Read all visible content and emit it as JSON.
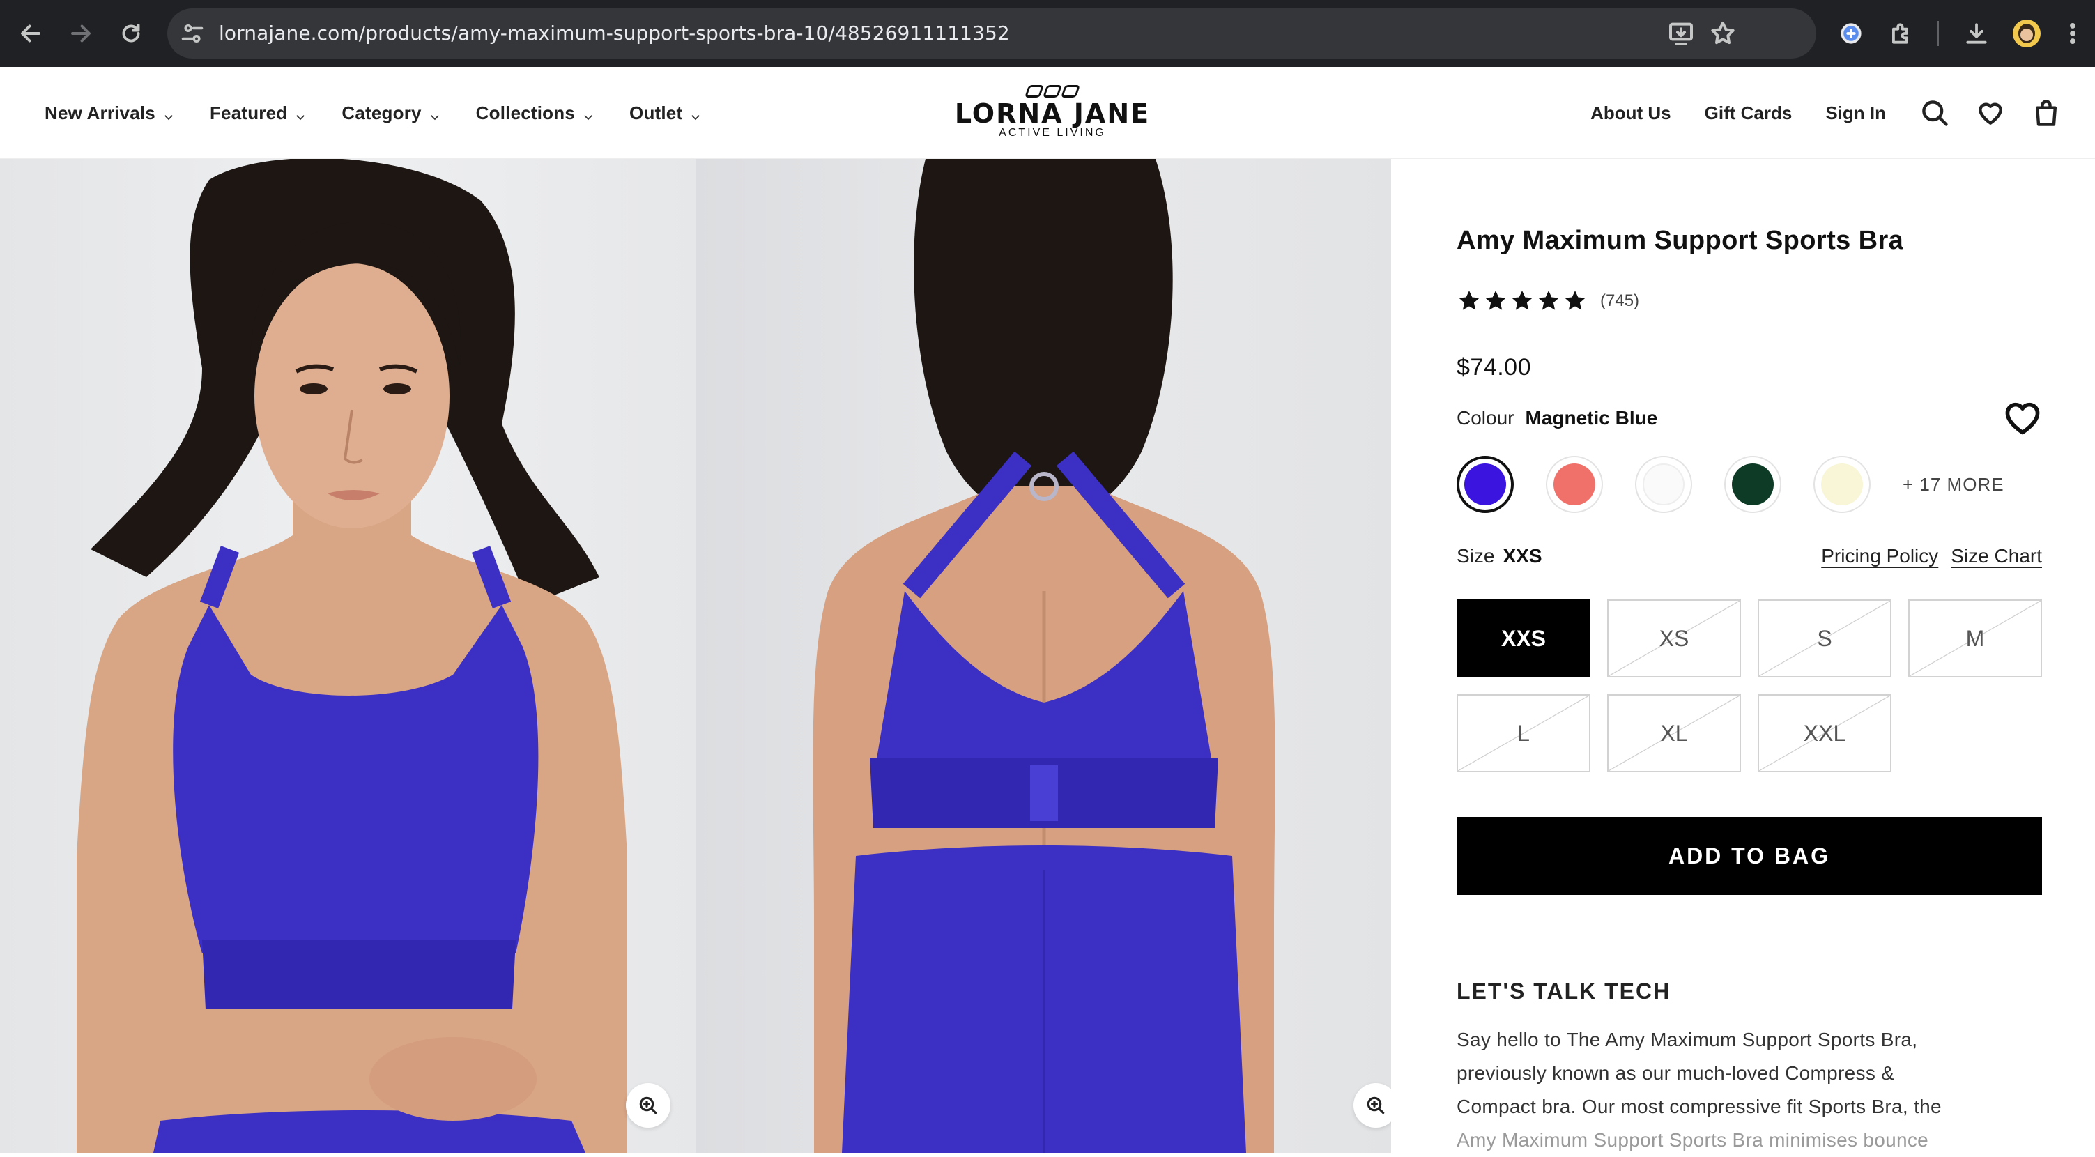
{
  "browser": {
    "url": "lornajane.com/products/amy-maximum-support-sports-bra-10/48526911111352"
  },
  "header": {
    "nav": [
      {
        "label": "New Arrivals"
      },
      {
        "label": "Featured"
      },
      {
        "label": "Category"
      },
      {
        "label": "Collections"
      },
      {
        "label": "Outlet"
      }
    ],
    "logo": {
      "name": "LORNA JANE",
      "tagline": "ACTIVE LIVING"
    },
    "links": {
      "about": "About Us",
      "gift_cards": "Gift Cards",
      "sign_in": "Sign In"
    }
  },
  "product": {
    "title": "Amy Maximum Support Sports Bra",
    "rating_value": 5,
    "review_count": "(745)",
    "price": "$74.00",
    "colour_label": "Colour",
    "colour_value": "Magnetic Blue",
    "swatches": [
      {
        "color": "#3b14e0",
        "selected": true
      },
      {
        "color": "#f0706a",
        "selected": false
      },
      {
        "color": "#fafafa",
        "selected": false
      },
      {
        "color": "#0d3b25",
        "selected": false
      },
      {
        "color": "#f8f6d6",
        "selected": false
      }
    ],
    "more_colours": "+ 17 MORE",
    "size_label": "Size",
    "size_value": "XXS",
    "pricing_policy": "Pricing Policy",
    "size_chart": "Size Chart",
    "sizes": [
      {
        "label": "XXS",
        "available": true,
        "selected": true
      },
      {
        "label": "XS",
        "available": false,
        "selected": false
      },
      {
        "label": "S",
        "available": false,
        "selected": false
      },
      {
        "label": "M",
        "available": false,
        "selected": false
      },
      {
        "label": "L",
        "available": false,
        "selected": false
      },
      {
        "label": "XL",
        "available": false,
        "selected": false
      },
      {
        "label": "XXL",
        "available": false,
        "selected": false
      }
    ],
    "add_to_bag": "ADD TO BAG",
    "tech_heading": "LET'S TALK TECH",
    "tech_line1": "Say hello to The Amy Maximum Support Sports Bra,",
    "tech_line2": "previously known as our much-loved Compress &",
    "tech_line3": "Compact bra. Our most compressive fit Sports Bra, the",
    "tech_line4": "Amy Maximum Support Sports Bra minimises bounce"
  },
  "colors": {
    "product_blue": "#3b2fc4",
    "skin": "#d8a585",
    "hair": "#1d1612"
  }
}
